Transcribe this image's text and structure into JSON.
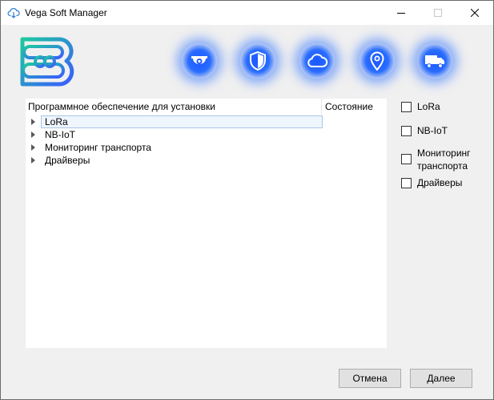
{
  "window": {
    "title": "Vega Soft Manager",
    "icons": [
      "cloud-download-icon",
      "minimize-icon",
      "maximize-icon",
      "close-icon"
    ]
  },
  "branding": {
    "logo": "vega-b-logo-icon",
    "colors": {
      "logo_start": "#1ec8a0",
      "logo_end": "#3a5cff",
      "accent_glow": "#2a6dff"
    }
  },
  "categories": [
    {
      "icon": "camera-icon"
    },
    {
      "icon": "shield-icon"
    },
    {
      "icon": "cloud-icon"
    },
    {
      "icon": "location-pin-icon"
    },
    {
      "icon": "truck-icon"
    }
  ],
  "tree": {
    "columns": [
      "Программное обеспечение для установки",
      "Состояние"
    ],
    "rows": [
      {
        "label": "LoRa",
        "selected": true
      },
      {
        "label": "NB-IoT",
        "selected": false
      },
      {
        "label": "Мониторинг транспорта",
        "selected": false
      },
      {
        "label": "Драйверы",
        "selected": false
      }
    ]
  },
  "filters": [
    {
      "label": "LoRa",
      "checked": false
    },
    {
      "label": "NB-IoT",
      "checked": false
    },
    {
      "label": "Мониторинг транспорта",
      "line1": "Мониторинг",
      "line2": "транспорта",
      "checked": false
    },
    {
      "label": "Драйверы",
      "checked": false
    }
  ],
  "buttons": {
    "cancel": "Отмена",
    "next": "Далее"
  }
}
